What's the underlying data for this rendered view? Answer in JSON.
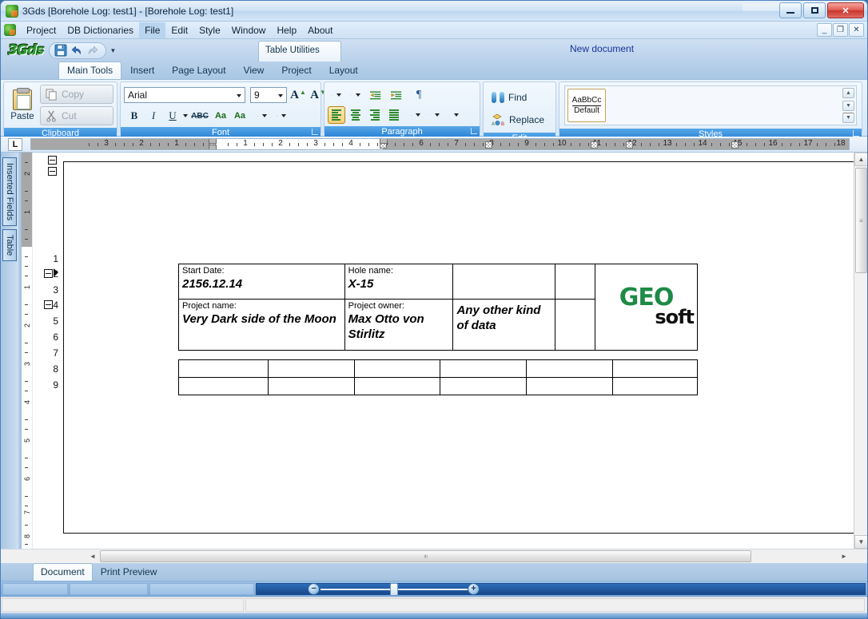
{
  "window": {
    "title": "3Gds [Borehole Log: test1] - [Borehole Log: test1]",
    "app_icon": "3gds-app-icon",
    "minimize": "minimize-icon",
    "maximize": "maximize-icon",
    "close": "✕"
  },
  "menubar": {
    "icon": "3gds-menu-icon",
    "items": [
      {
        "label": "Project",
        "active": false
      },
      {
        "label": "DB Dictionaries",
        "active": false
      },
      {
        "label": "File",
        "active": true
      },
      {
        "label": "Edit",
        "active": false
      },
      {
        "label": "Style",
        "active": false
      },
      {
        "label": "Window",
        "active": false
      },
      {
        "label": "Help",
        "active": false
      },
      {
        "label": "About",
        "active": false
      }
    ],
    "mdi_buttons": [
      "_",
      "❐",
      "✕"
    ]
  },
  "quickaccess": {
    "logo": "3Gds",
    "buttons": [
      "save-icon",
      "undo-icon",
      "redo-icon"
    ],
    "dropdown": "▾",
    "contextual_tab": "Table Utilities",
    "document_status": "New document"
  },
  "ribbon": {
    "tabs": [
      {
        "label": "Main Tools",
        "selected": true
      },
      {
        "label": "Insert",
        "selected": false
      },
      {
        "label": "Page Layout",
        "selected": false
      },
      {
        "label": "View",
        "selected": false
      },
      {
        "label": "Project",
        "selected": false
      },
      {
        "label": "Layout",
        "selected": false
      }
    ],
    "groups": {
      "clipboard": {
        "label": "Clipboard",
        "paste": "Paste",
        "copy": "Copy",
        "cut": "Cut"
      },
      "font": {
        "label": "Font",
        "font_name": "Arial",
        "font_size": "9",
        "grow_font": "A",
        "shrink_font": "A",
        "bold": "B",
        "italic": "I",
        "underline": "U",
        "strikethrough": "ABC",
        "change_case": "Aa",
        "clear_format": "Aa",
        "highlight": "highlight-icon",
        "font_color": "font-color-icon"
      },
      "paragraph": {
        "label": "Paragraph",
        "bullets": "bullet-list-icon",
        "numbering": "numbered-list-icon",
        "decrease_indent": "decrease-indent-icon",
        "increase_indent": "increase-indent-icon",
        "show_marks": "¶",
        "align_left": "align-left-icon",
        "align_center": "align-center-icon",
        "align_right": "align-right-icon",
        "justify": "justify-icon",
        "line_spacing": "line-spacing-icon",
        "shading": "shading-icon",
        "borders": "borders-icon"
      },
      "edit": {
        "label": "Edit",
        "find": "Find",
        "replace": "Replace"
      },
      "styles": {
        "label": "Styles",
        "items": [
          {
            "sample": "AaBbCc",
            "name": "Default"
          }
        ],
        "scroll_up": "▲",
        "scroll_down": "▼",
        "more": "▼"
      }
    }
  },
  "ruler": {
    "tab_selector": "L",
    "numbers": [
      "3",
      "2",
      "1",
      "1",
      "2",
      "3",
      "4",
      "5",
      "6",
      "7",
      "8",
      "9",
      "10",
      "11",
      "12",
      "13",
      "14",
      "15",
      "16",
      "17",
      "18"
    ]
  },
  "vertical_tabs": [
    {
      "label": "Inserted Fields"
    },
    {
      "label": "Table"
    }
  ],
  "outline": {
    "line_numbers": [
      "1",
      "2",
      "3",
      "4",
      "5",
      "6",
      "7",
      "8",
      "9"
    ]
  },
  "vruler": {
    "numbers": [
      "2",
      "1",
      "1",
      "2",
      "3",
      "4",
      "5",
      "6",
      "7",
      "8"
    ]
  },
  "document": {
    "header_table": {
      "rows": [
        [
          {
            "label": "Start Date:",
            "value": "2156.12.14"
          },
          {
            "label": "Hole name:",
            "value": "X-15"
          },
          {
            "label": "",
            "value": ""
          },
          {
            "label": "",
            "value": ""
          },
          {
            "label": "",
            "value": "",
            "logo": "GEO soft"
          }
        ],
        [
          {
            "label": "Project name:",
            "value": "Very Dark side of the Moon"
          },
          {
            "label": "Project owner:",
            "value": "Max Otto von Stirlitz"
          },
          {
            "label": "",
            "value": "Any other kind of data"
          },
          {
            "label": "",
            "value": ""
          },
          {
            "label": "",
            "value": ""
          }
        ]
      ],
      "logo_main": "GEO",
      "logo_sub": "soft"
    },
    "empty_table": {
      "rows": 2,
      "cols": 6
    }
  },
  "bottom_tabs": [
    {
      "label": "Document",
      "selected": true
    },
    {
      "label": "Print Preview",
      "selected": false
    }
  ],
  "statusbar": {
    "panels": [
      "",
      "",
      ""
    ],
    "zoom_out": "−",
    "zoom_in": "+",
    "panels2": [
      "",
      ""
    ]
  },
  "scrollbars": {
    "up_arrow": "▲",
    "down_arrow": "▼",
    "left_arrow": "◄",
    "right_arrow": "►",
    "grip": "≡"
  },
  "colors": {
    "accent_blue": "#2a82d4",
    "title_blue": "#15349b",
    "logo_green": "#2f9a33",
    "geo_green": "#1e8a46",
    "close_red": "#c8352d"
  }
}
